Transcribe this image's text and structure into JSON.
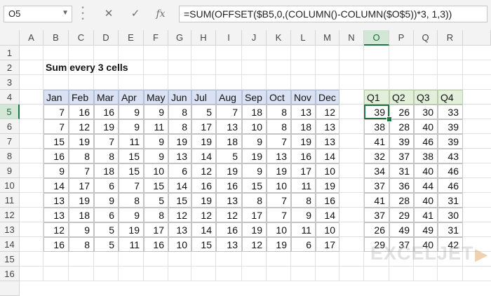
{
  "namebox": {
    "value": "O5"
  },
  "formula_bar": {
    "cancel_icon": "close-icon",
    "enter_icon": "check-icon",
    "fx_label": "fx",
    "formula": "=SUM(OFFSET($B5,0,(COLUMN()-COLUMN($O$5))*3, 1,3))"
  },
  "columns": [
    "A",
    "B",
    "C",
    "D",
    "E",
    "F",
    "G",
    "H",
    "I",
    "J",
    "K",
    "L",
    "M",
    "N",
    "O",
    "P",
    "Q",
    "R"
  ],
  "selected_column": "O",
  "rows": [
    "1",
    "2",
    "3",
    "4",
    "5",
    "6",
    "7",
    "8",
    "9",
    "10",
    "11",
    "12",
    "13",
    "14",
    "15",
    "16"
  ],
  "selected_row": "5",
  "title": "Sum every 3 cells",
  "months": [
    "Jan",
    "Feb",
    "Mar",
    "Apr",
    "May",
    "Jun",
    "Jul",
    "Aug",
    "Sep",
    "Oct",
    "Nov",
    "Dec"
  ],
  "month_data": [
    [
      7,
      16,
      16,
      9,
      9,
      8,
      5,
      7,
      18,
      8,
      13,
      12
    ],
    [
      7,
      12,
      19,
      9,
      11,
      8,
      17,
      13,
      10,
      8,
      18,
      13
    ],
    [
      15,
      19,
      7,
      11,
      9,
      19,
      19,
      18,
      9,
      7,
      19,
      13
    ],
    [
      16,
      8,
      8,
      15,
      9,
      13,
      14,
      5,
      19,
      13,
      16,
      14
    ],
    [
      9,
      7,
      18,
      15,
      10,
      6,
      12,
      19,
      9,
      19,
      17,
      10
    ],
    [
      14,
      17,
      6,
      7,
      15,
      14,
      16,
      16,
      15,
      10,
      11,
      19
    ],
    [
      13,
      19,
      9,
      8,
      5,
      15,
      19,
      13,
      8,
      7,
      8,
      16
    ],
    [
      13,
      18,
      6,
      9,
      8,
      12,
      12,
      12,
      17,
      7,
      9,
      14
    ],
    [
      12,
      9,
      5,
      19,
      17,
      13,
      14,
      16,
      19,
      10,
      11,
      10
    ],
    [
      16,
      8,
      5,
      11,
      16,
      10,
      15,
      13,
      12,
      19,
      6,
      17
    ]
  ],
  "quarters": [
    "Q1",
    "Q2",
    "Q3",
    "Q4"
  ],
  "quarter_data": [
    [
      39,
      26,
      30,
      33
    ],
    [
      38,
      28,
      40,
      39
    ],
    [
      41,
      39,
      46,
      39
    ],
    [
      32,
      37,
      38,
      43
    ],
    [
      34,
      31,
      40,
      46
    ],
    [
      37,
      36,
      44,
      46
    ],
    [
      41,
      28,
      40,
      31
    ],
    [
      37,
      29,
      41,
      30
    ],
    [
      26,
      49,
      49,
      31
    ],
    [
      29,
      37,
      40,
      42
    ]
  ],
  "watermark": "EXCELJET"
}
